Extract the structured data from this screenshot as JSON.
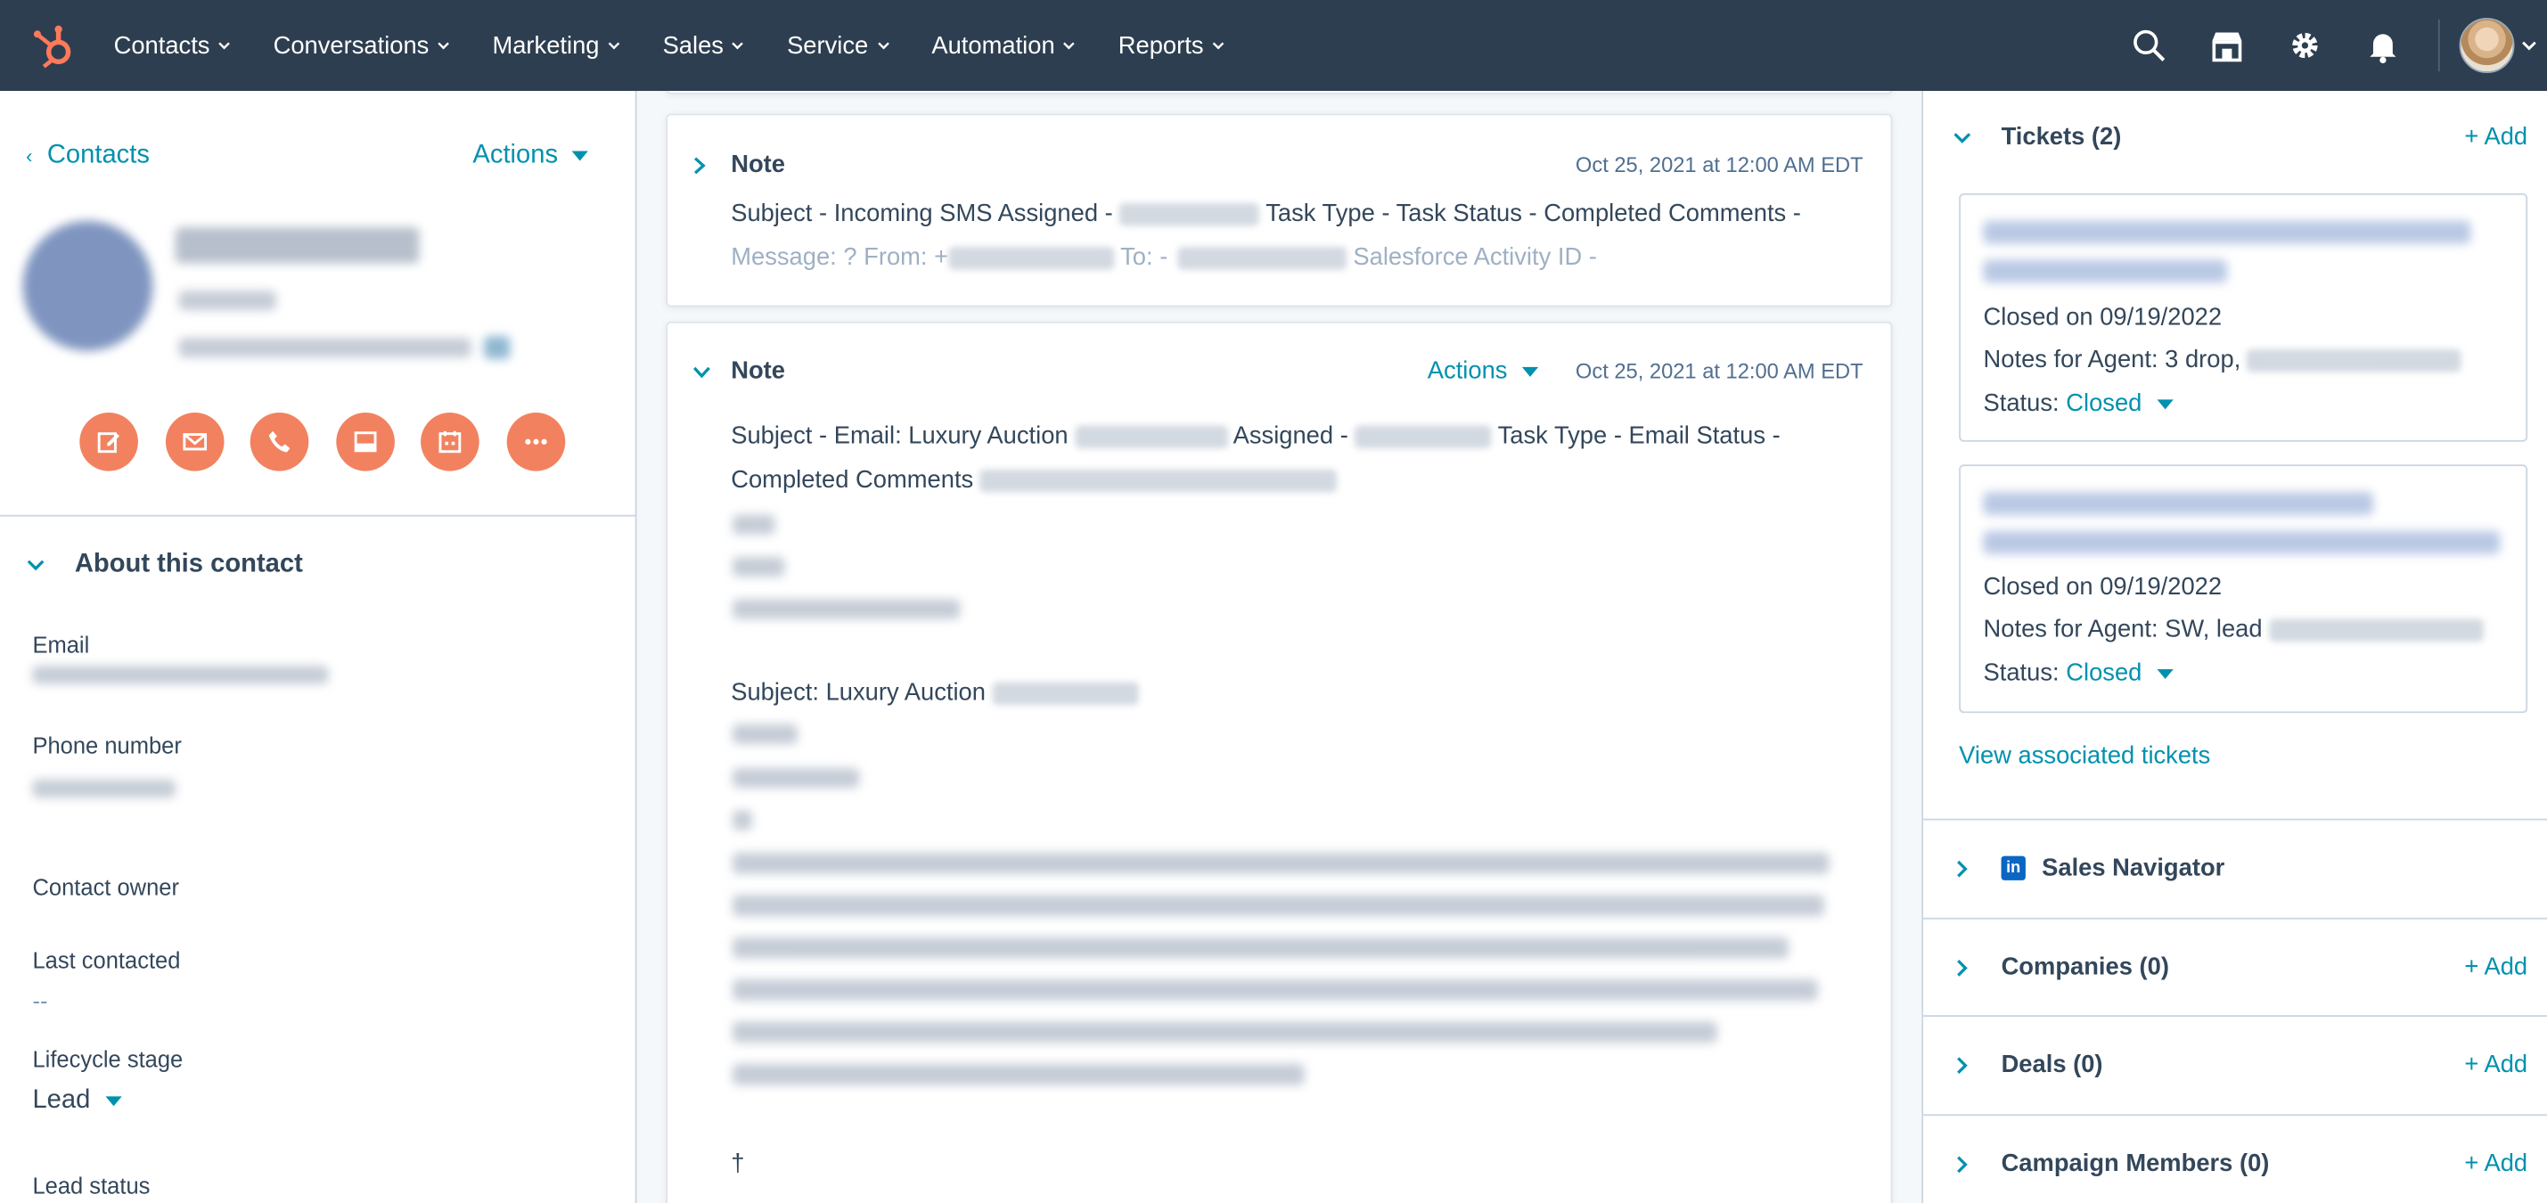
{
  "nav": {
    "items": [
      "Contacts",
      "Conversations",
      "Marketing",
      "Sales",
      "Service",
      "Automation",
      "Reports"
    ]
  },
  "left": {
    "back_label": "Contacts",
    "actions_label": "Actions",
    "about_title": "About this contact",
    "props": {
      "email_label": "Email",
      "phone_label": "Phone number",
      "owner_label": "Contact owner",
      "last_contacted_label": "Last contacted",
      "last_contacted_value": "--",
      "lifecycle_label": "Lifecycle stage",
      "lifecycle_value": "Lead",
      "lead_status_label": "Lead status"
    }
  },
  "timeline": {
    "note1": {
      "title": "Note",
      "date": "Oct 25, 2021 at 12:00 AM EDT",
      "line1a": "Subject - Incoming SMS Assigned - ",
      "line1b": " Task Type - Task Status - Completed Comments -",
      "line2a": "Message: ? From: +",
      "line2b": " To: -",
      "line2c": " Salesforce Activity ID -"
    },
    "note2": {
      "title": "Note",
      "actions_label": "Actions",
      "date": "Oct 25, 2021 at 12:00 AM EDT",
      "line1a": "Subject - Email: Luxury Auction ",
      "line1b": " Assigned - ",
      "line1c": " Task Type - Email Status -",
      "line2a": "Completed Comments ",
      "subject2": "Subject: Luxury Auction ",
      "dagger": "†"
    }
  },
  "right": {
    "tickets_title": "Tickets (2)",
    "add_label": "+ Add",
    "tickets": [
      {
        "closed": "Closed on 09/19/2022",
        "notes": "Notes for Agent: 3 drop,",
        "status_label": "Status:",
        "status": "Closed"
      },
      {
        "closed": "Closed on 09/19/2022",
        "notes": "Notes for Agent: SW, lead",
        "status_label": "Status:",
        "status": "Closed"
      }
    ],
    "view_tickets": "View associated tickets",
    "sales_nav": "Sales Navigator",
    "companies": "Companies (0)",
    "deals": "Deals (0)",
    "campaign": "Campaign Members (0)"
  },
  "colors": {
    "nav_bg": "#2d3e50",
    "accent": "#0091ae",
    "action_orange": "#f2825f",
    "brand_orange": "#ff7a59"
  }
}
